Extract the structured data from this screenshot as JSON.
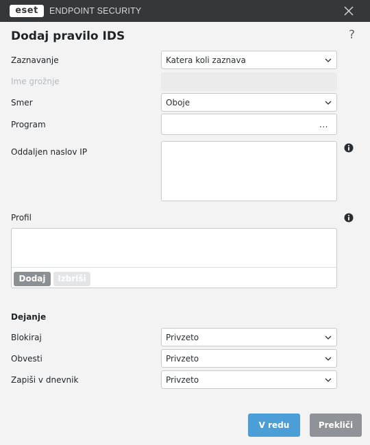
{
  "titlebar": {
    "logo": "eset",
    "app_name": "ENDPOINT SECURITY",
    "close_icon": "close-icon"
  },
  "dialog": {
    "title": "Dodaj pravilo IDS",
    "help": "?"
  },
  "form": {
    "detection": {
      "label": "Zaznavanje",
      "value": "Katera koli zaznava"
    },
    "threat_name": {
      "label": "Ime grožnje",
      "value": ""
    },
    "direction": {
      "label": "Smer",
      "value": "Oboje"
    },
    "application": {
      "label": "Program",
      "value": "",
      "browse": "..."
    },
    "remote_ip": {
      "label": "Oddaljen naslov IP",
      "value": ""
    },
    "profile": {
      "label": "Profil",
      "items": [],
      "add_label": "Dodaj",
      "delete_label": "Izbriši"
    }
  },
  "action": {
    "heading": "Dejanje",
    "block": {
      "label": "Blokiraj",
      "value": "Privzeto"
    },
    "notify": {
      "label": "Obvesti",
      "value": "Privzeto"
    },
    "log": {
      "label": "Zapiši v dnevnik",
      "value": "Privzeto"
    }
  },
  "footer": {
    "ok_label": "V redu",
    "cancel_label": "Prekliči"
  },
  "colors": {
    "titlebar": "#34383b",
    "background": "#f3f3f4",
    "primary": "#4c9fd6",
    "secondary": "#8f9397"
  }
}
